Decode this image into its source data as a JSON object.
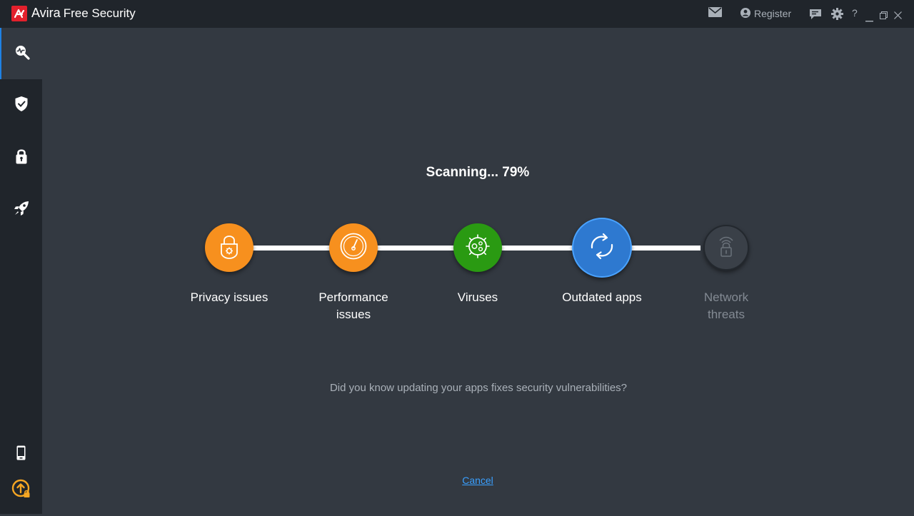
{
  "titlebar": {
    "brand": "Avira",
    "product": "Free Security",
    "register_label": "Register",
    "help_label": "?",
    "icons": [
      "mail-icon",
      "user-icon",
      "feedback-icon",
      "gear-icon",
      "minimize-icon",
      "restore-icon",
      "close-icon"
    ]
  },
  "sidebar": {
    "items": [
      {
        "name": "scan",
        "icon": "scan-icon",
        "active": true
      },
      {
        "name": "security",
        "icon": "shield-icon"
      },
      {
        "name": "privacy",
        "icon": "lock-icon"
      },
      {
        "name": "performance",
        "icon": "rocket-icon"
      },
      {
        "name": "mobile",
        "icon": "phone-icon"
      },
      {
        "name": "upgrade",
        "icon": "upgrade-icon"
      }
    ]
  },
  "scan": {
    "title": "Scanning... 79%",
    "progress_percent": 79,
    "steps": [
      {
        "label": "Privacy issues",
        "state": "done",
        "color": "#f7901e",
        "icon": "privacy-lock-icon"
      },
      {
        "label": "Performance issues",
        "state": "done",
        "color": "#f7901e",
        "icon": "speedometer-icon"
      },
      {
        "label": "Viruses",
        "state": "done",
        "color": "#2a9a12",
        "icon": "virus-icon"
      },
      {
        "label": "Outdated apps",
        "state": "active",
        "color": "#2e79d0",
        "icon": "refresh-icon"
      },
      {
        "label": "Network threats",
        "state": "pending",
        "color": "#3a4048",
        "icon": "network-lock-icon"
      }
    ],
    "tip": "Did you know updating your apps fixes security vulnerabilities?",
    "cancel_label": "Cancel"
  },
  "colors": {
    "background": "#333941",
    "sidebar": "#20252b",
    "accent": "#1e82e5",
    "brand_red": "#e2202c"
  }
}
